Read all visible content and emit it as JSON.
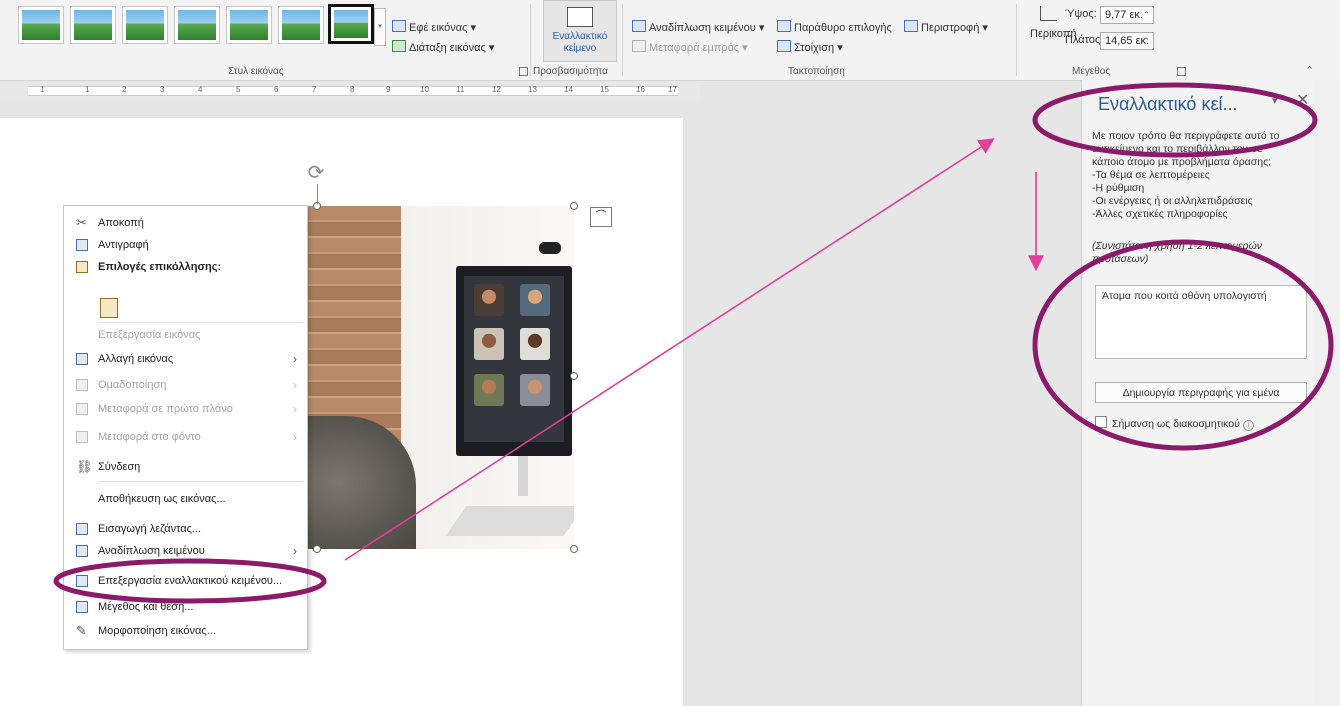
{
  "ribbon": {
    "picture_styles": {
      "effects_label": "Εφέ εικόνας",
      "layout_label": "Διάταξη εικόνας",
      "group_label": "Στυλ εικόνας"
    },
    "accessibility": {
      "alt_button_line1": "Εναλλακτικό",
      "alt_button_line2": "κείμενο",
      "group_label": "Προσβασιμότητα"
    },
    "arrange": {
      "wrap_text": "Αναδίπλωση κειμένου",
      "selection_pane": "Παράθυρο επιλογής",
      "rotate": "Περιστροφή",
      "bring_forward": "Μεταφορά εμπρός",
      "align": "Στοίχιση",
      "group_label": "Τακτοποίηση"
    },
    "size": {
      "crop_label": "Περικοπή",
      "height_label": "Ύψος:",
      "height_value": "9,77 εκ.",
      "width_label": "Πλάτος:",
      "width_value": "14,65 εκ.",
      "group_label": "Μέγεθος"
    }
  },
  "ruler": {
    "ticks": [
      "1",
      "1",
      "2",
      "3",
      "4",
      "5",
      "6",
      "7",
      "8",
      "9",
      "10",
      "11",
      "12",
      "13",
      "14",
      "15",
      "16",
      "17"
    ]
  },
  "context_menu": {
    "items": [
      {
        "label": "Αποκοπή",
        "state": "enabled"
      },
      {
        "label": "Αντιγραφή",
        "state": "enabled"
      },
      {
        "label": "Επιλογές επικόλλησης:",
        "state": "bold"
      },
      {
        "label": "Επεξεργασία εικόνας",
        "state": "disabled"
      },
      {
        "label": "Αλλαγή εικόνας",
        "state": "enabled"
      },
      {
        "label": "Ομαδοποίηση",
        "state": "disabled"
      },
      {
        "label": "Μεταφορά σε πρώτο πλάνο",
        "state": "disabled"
      },
      {
        "label": "Μεταφορά στο φόντο",
        "state": "disabled"
      },
      {
        "label": "Σύνδεση",
        "state": "enabled"
      },
      {
        "label": "Αποθήκευση ως εικόνας...",
        "state": "enabled"
      },
      {
        "label": "Εισαγωγή λεζάντας...",
        "state": "enabled"
      },
      {
        "label": "Αναδίπλωση κειμένου",
        "state": "enabled"
      },
      {
        "label": "Επεξεργασία εναλλακτικού κειμένου...",
        "state": "highlighted"
      },
      {
        "label": "Μέγεθος και θέση...",
        "state": "enabled"
      },
      {
        "label": "Μορφοποίηση εικόνας...",
        "state": "enabled"
      }
    ]
  },
  "alt_text_pane": {
    "title": "Εναλλακτικό κεί...",
    "description_lines": [
      "Με ποιον τρόπο θα περιγράφετε αυτό το",
      "αντικείμενο και το περιβάλλον του σε",
      "κάποιο άτομο με προβλήματα όρασης;",
      "-Τα θέμα σε λεπτομέρειες",
      "-Η ρύθμιση",
      "-Οι ενέργειες ή οι αλληλεπιδράσεις",
      "-Άλλες σχετικές πληροφορίες"
    ],
    "hint_lines": [
      "(Συνιστάται η χρήση 1-2 λεπτομερών",
      "προτάσεων)"
    ],
    "alt_text_value": "Άτομα που κοιτά οθόνη υπολογιστή",
    "generate_button": "Δημιουργία περιγραφής για εμένα",
    "decorative_label": "Σήμανση ως διακοσμητικού"
  },
  "colors": {
    "annotation": "#8b1a6b",
    "arrow": "#e0409a",
    "pane_title": "#2a5b9a"
  }
}
